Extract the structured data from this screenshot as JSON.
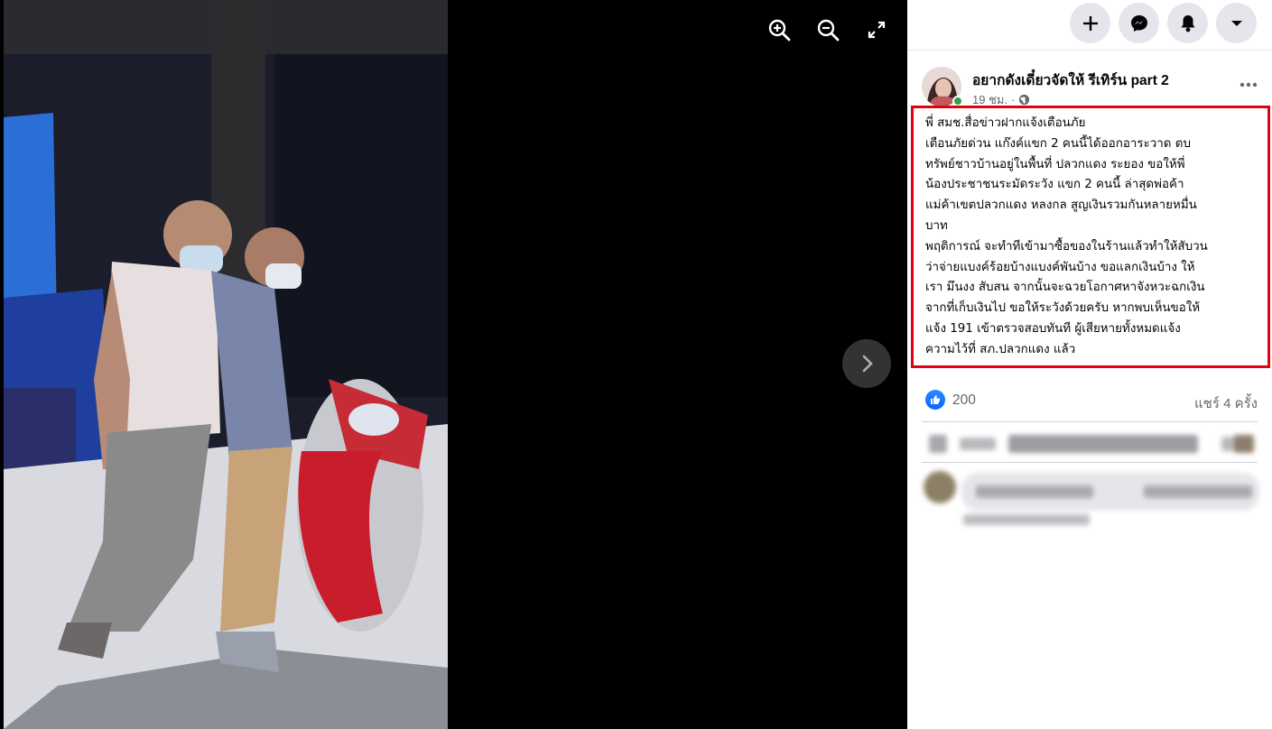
{
  "viewer": {
    "icons": [
      "zoom-in-icon",
      "zoom-out-icon",
      "fullscreen-icon",
      "chevron-right-icon"
    ]
  },
  "topbar": {
    "icons": [
      "plus-icon",
      "messenger-icon",
      "bell-icon",
      "caret-down-icon"
    ]
  },
  "post": {
    "page_name": "อยากดังเดี๋ยวจัดให้ รีเทิร์น part 2",
    "time": "19 ชม.",
    "audience_icon": "globe-icon",
    "text_lines": [
      "พี่ สมช.สื่อข่าวฝากแจ้งเตือนภัย",
      "เตือนภัยด่วน แก๊งค์แขก 2 คนนี้ได้ออกอาระวาด ตบ",
      "ทรัพย์ชาวบ้านอยู่ในพื้นที่ ปลวกแดง ระยอง ขอให้พี่",
      "น้องประชาชนระมัดระวัง แขก 2 คนนี้ ล่าสุดพ่อค้า",
      "แม่ค้าเขตปลวกแดง หลงกล สูญเงินรวมกันหลายหมื่น",
      "บาท",
      "พฤติการณ์ จะทำทีเข้ามาซื้อของในร้านแล้วทำให้สับวน",
      "ว่าจ่ายแบงค์ร้อยบ้างแบงค์พันบ้าง ขอแลกเงินบ้าง ให้",
      "เรา มึนงง สับสน จากนั้นจะฉวยโอกาศหาจังหวะฉกเงิน",
      "จากที่เก็บเงินไป ขอให้ระวังด้วยครับ หากพบเห็นขอให้",
      "แจ้ง 191 เข้าตรวจสอบทันที ผู้เสียหายทั้งหมดแจ้ง",
      "ความไว้ที่ สภ.ปลวกแดง แล้ว"
    ],
    "like_count": "200",
    "shares": "แชร์ 4 ครั้ง"
  },
  "colors": {
    "highlight_border": "#e3000f",
    "like_blue": "#0866ff",
    "online_green": "#31a24c"
  }
}
